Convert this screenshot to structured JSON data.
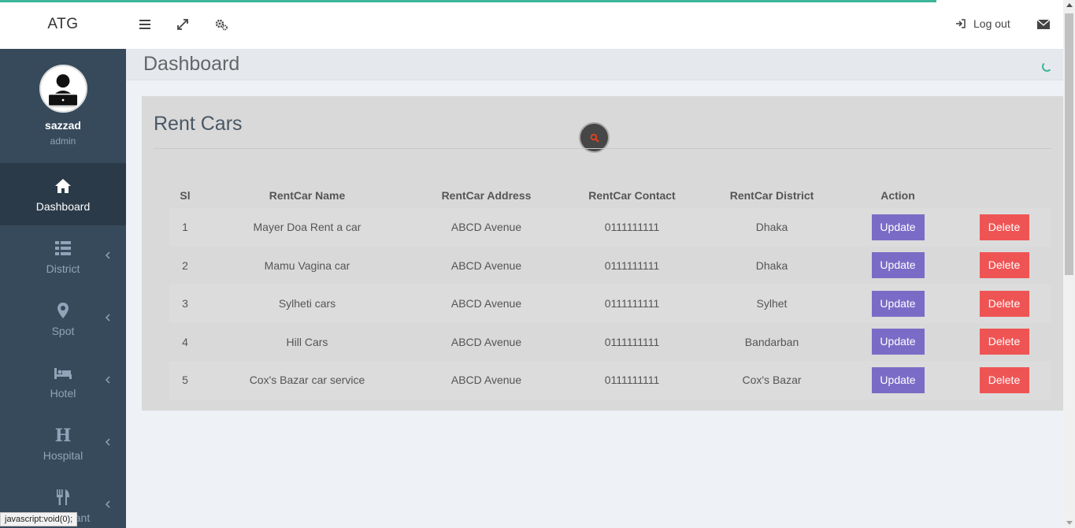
{
  "header": {
    "brand": "ATG",
    "logout_label": "Log out"
  },
  "user": {
    "name": "sazzad",
    "role": "admin"
  },
  "sidebar": {
    "items": [
      {
        "label": "Dashboard",
        "icon": "home-icon"
      },
      {
        "label": "District",
        "icon": "list-icon"
      },
      {
        "label": "Spot",
        "icon": "map-marker-icon"
      },
      {
        "label": "Hotel",
        "icon": "bed-icon"
      },
      {
        "label": "Hospital",
        "icon": "hospital-h-icon"
      },
      {
        "label": "Restaurant",
        "icon": "cutlery-icon"
      }
    ]
  },
  "page": {
    "title": "Dashboard"
  },
  "panel": {
    "title": "Rent Cars",
    "table": {
      "headers": [
        "Sl",
        "RentCar Name",
        "RentCar Address",
        "RentCar Contact",
        "RentCar District",
        "Action"
      ],
      "rows": [
        {
          "sl": "1",
          "name": "Mayer Doa Rent a car",
          "address": "ABCD Avenue",
          "contact": "0111111111",
          "district": "Dhaka",
          "update": "Update",
          "delete": "Delete"
        },
        {
          "sl": "2",
          "name": "Mamu Vagina car",
          "address": "ABCD Avenue",
          "contact": "0111111111",
          "district": "Dhaka",
          "update": "Update",
          "delete": "Delete"
        },
        {
          "sl": "3",
          "name": "Sylheti cars",
          "address": "ABCD Avenue",
          "contact": "0111111111",
          "district": "Sylhet",
          "update": "Update",
          "delete": "Delete"
        },
        {
          "sl": "4",
          "name": "Hill Cars",
          "address": "ABCD Avenue",
          "contact": "0111111111",
          "district": "Bandarban",
          "update": "Update",
          "delete": "Delete"
        },
        {
          "sl": "5",
          "name": "Cox's Bazar car service",
          "address": "ABCD Avenue",
          "contact": "0111111111",
          "district": "Cox's Bazar",
          "update": "Update",
          "delete": "Delete"
        }
      ]
    }
  },
  "status_bar": "javascript:void(0);",
  "colors": {
    "sidebar": "#374a5c",
    "accent": "#3fb59a",
    "update_button": "#7a6cc6",
    "delete_button": "#ef5454"
  }
}
